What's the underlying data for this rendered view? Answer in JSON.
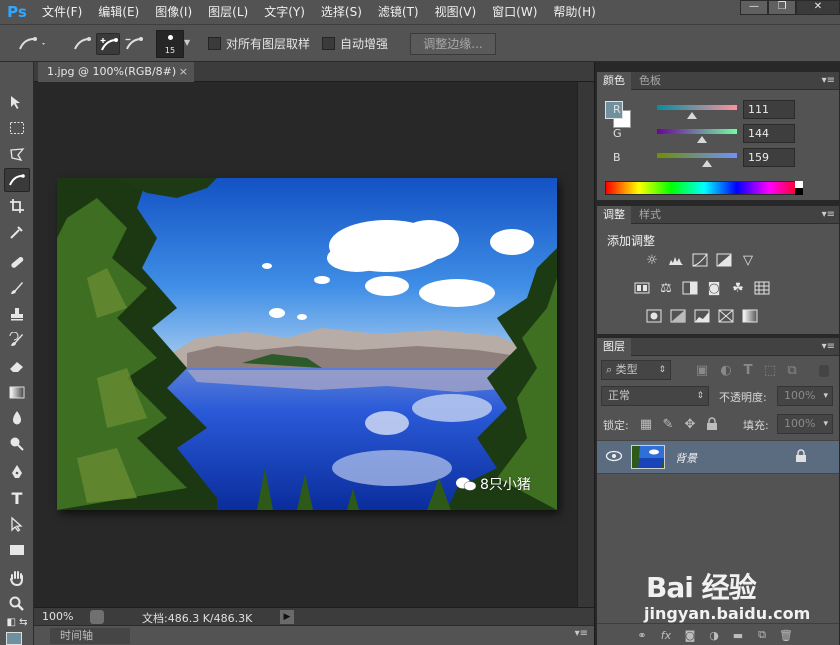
{
  "app": {
    "logo": "Ps"
  },
  "menu": [
    "文件(F)",
    "编辑(E)",
    "图像(I)",
    "图层(L)",
    "文字(Y)",
    "选择(S)",
    "滤镜(T)",
    "视图(V)",
    "窗口(W)",
    "帮助(H)"
  ],
  "window_controls": {
    "minimize": "—",
    "restore": "❐",
    "close": "✕"
  },
  "options_bar": {
    "brush_size": "15",
    "sample_all_layers": {
      "label": "对所有图层取样",
      "checked": false
    },
    "auto_enhance": {
      "label": "自动增强",
      "checked": false
    },
    "refine_edge": "调整边缘..."
  },
  "document": {
    "tab_title": "1.jpg @ 100%(RGB/8#)",
    "tab_close": "×",
    "zoom": "100%",
    "doc_size": "文档:486.3 K/486.3K",
    "watermark": "8只小猪"
  },
  "timeline": {
    "label": "时间轴"
  },
  "color_panel": {
    "tabs": [
      "颜色",
      "色板"
    ],
    "r": {
      "label": "R",
      "value": "111"
    },
    "g": {
      "label": "G",
      "value": "144"
    },
    "b": {
      "label": "B",
      "value": "159"
    },
    "foreground": "#6f909f",
    "background": "#ffffff"
  },
  "adjustments_panel": {
    "tabs": [
      "调整",
      "样式"
    ],
    "title": "添加调整"
  },
  "layers_panel": {
    "tab": "图层",
    "filter_kind": "类型",
    "blend_mode": "正常",
    "opacity_label": "不透明度:",
    "opacity_value": "100%",
    "lock_label": "锁定:",
    "fill_label": "填充:",
    "fill_value": "100%",
    "layers": [
      {
        "name": "背景",
        "visible": true,
        "locked": true
      }
    ]
  },
  "baidu_watermark": {
    "logo": "Bai 经验",
    "url": "jingyan.baidu.com"
  },
  "colors": {
    "accent": "#31a8ff",
    "ui_panel": "#535353",
    "layer_selected": "#5b6b80"
  }
}
